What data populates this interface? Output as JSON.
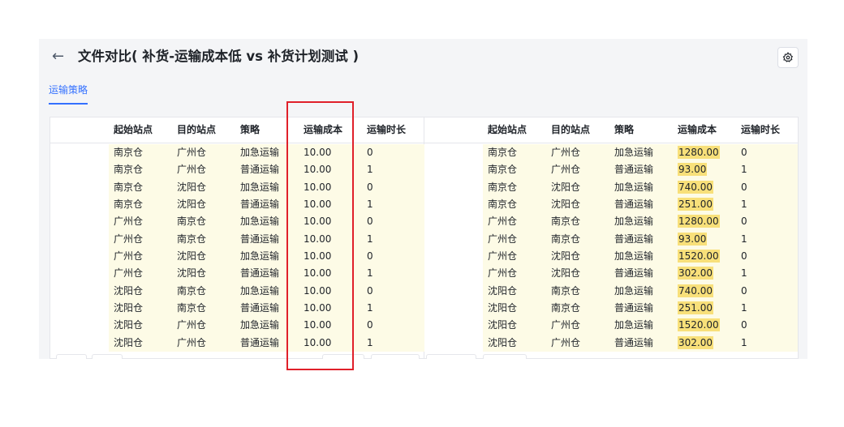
{
  "header": {
    "back_icon": "arrow-left-icon",
    "title": "文件对比( 补货-运输成本低 vs 补货计划测试 )",
    "settings_icon": "gear-icon"
  },
  "tabs": [
    {
      "label": "运输策略",
      "active": true
    }
  ],
  "left_table": {
    "columns": [
      "起始站点",
      "目的站点",
      "策略",
      "运输成本",
      "运输时长"
    ],
    "rows": [
      [
        "南京仓",
        "广州仓",
        "加急运输",
        "10.00",
        "0"
      ],
      [
        "南京仓",
        "广州仓",
        "普通运输",
        "10.00",
        "1"
      ],
      [
        "南京仓",
        "沈阳仓",
        "加急运输",
        "10.00",
        "0"
      ],
      [
        "南京仓",
        "沈阳仓",
        "普通运输",
        "10.00",
        "1"
      ],
      [
        "广州仓",
        "南京仓",
        "加急运输",
        "10.00",
        "0"
      ],
      [
        "广州仓",
        "南京仓",
        "普通运输",
        "10.00",
        "1"
      ],
      [
        "广州仓",
        "沈阳仓",
        "加急运输",
        "10.00",
        "0"
      ],
      [
        "广州仓",
        "沈阳仓",
        "普通运输",
        "10.00",
        "1"
      ],
      [
        "沈阳仓",
        "南京仓",
        "加急运输",
        "10.00",
        "0"
      ],
      [
        "沈阳仓",
        "南京仓",
        "普通运输",
        "10.00",
        "1"
      ],
      [
        "沈阳仓",
        "广州仓",
        "加急运输",
        "10.00",
        "0"
      ],
      [
        "沈阳仓",
        "广州仓",
        "普通运输",
        "10.00",
        "1"
      ]
    ]
  },
  "right_table": {
    "columns": [
      "起始站点",
      "目的站点",
      "策略",
      "运输成本",
      "运输时长"
    ],
    "rows": [
      [
        "南京仓",
        "广州仓",
        "加急运输",
        "1280.00",
        "0"
      ],
      [
        "南京仓",
        "广州仓",
        "普通运输",
        "93.00",
        "1"
      ],
      [
        "南京仓",
        "沈阳仓",
        "加急运输",
        "740.00",
        "0"
      ],
      [
        "南京仓",
        "沈阳仓",
        "普通运输",
        "251.00",
        "1"
      ],
      [
        "广州仓",
        "南京仓",
        "加急运输",
        "1280.00",
        "0"
      ],
      [
        "广州仓",
        "南京仓",
        "普通运输",
        "93.00",
        "1"
      ],
      [
        "广州仓",
        "沈阳仓",
        "加急运输",
        "1520.00",
        "0"
      ],
      [
        "广州仓",
        "沈阳仓",
        "普通运输",
        "302.00",
        "1"
      ],
      [
        "沈阳仓",
        "南京仓",
        "加急运输",
        "740.00",
        "0"
      ],
      [
        "沈阳仓",
        "南京仓",
        "普通运输",
        "251.00",
        "1"
      ],
      [
        "沈阳仓",
        "广州仓",
        "加急运输",
        "1520.00",
        "0"
      ],
      [
        "沈阳仓",
        "广州仓",
        "普通运输",
        "302.00",
        "1"
      ]
    ],
    "highlighted_column": 3
  },
  "colors": {
    "accent": "#3370ff",
    "row_bg": "#fdfbe6",
    "diff_highlight": "#f8e07a",
    "annotation_box": "#e0202a"
  }
}
